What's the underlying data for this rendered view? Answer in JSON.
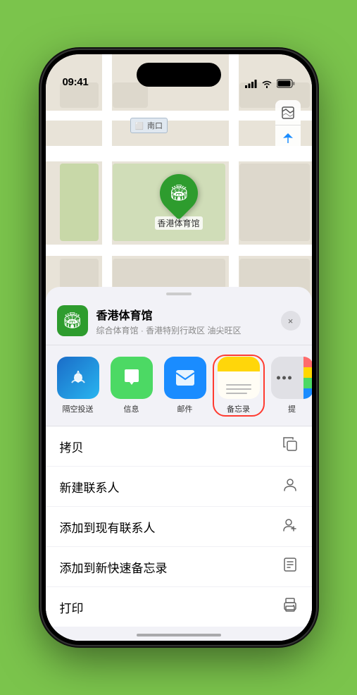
{
  "status_bar": {
    "time": "09:41",
    "signal_icon": "📶",
    "wifi_icon": "wifi",
    "battery_icon": "battery"
  },
  "map": {
    "label": "南口",
    "controls": {
      "map_type_icon": "🗺",
      "location_icon": "➤"
    }
  },
  "marker": {
    "label": "香港体育馆"
  },
  "location_header": {
    "name": "香港体育馆",
    "subtitle": "综合体育馆 · 香港特别行政区 油尖旺区",
    "close_label": "×"
  },
  "app_icons": [
    {
      "id": "airdrop",
      "label": "隔空投送",
      "selected": false
    },
    {
      "id": "message",
      "label": "信息",
      "selected": false
    },
    {
      "id": "mail",
      "label": "邮件",
      "selected": false
    },
    {
      "id": "notes",
      "label": "备忘录",
      "selected": true
    },
    {
      "id": "more",
      "label": "提",
      "selected": false
    }
  ],
  "menu_items": [
    {
      "id": "copy",
      "label": "拷贝",
      "icon": "copy"
    },
    {
      "id": "new-contact",
      "label": "新建联系人",
      "icon": "person"
    },
    {
      "id": "add-contact",
      "label": "添加到现有联系人",
      "icon": "person-add"
    },
    {
      "id": "quick-note",
      "label": "添加到新快速备忘录",
      "icon": "note"
    },
    {
      "id": "print",
      "label": "打印",
      "icon": "printer"
    }
  ]
}
